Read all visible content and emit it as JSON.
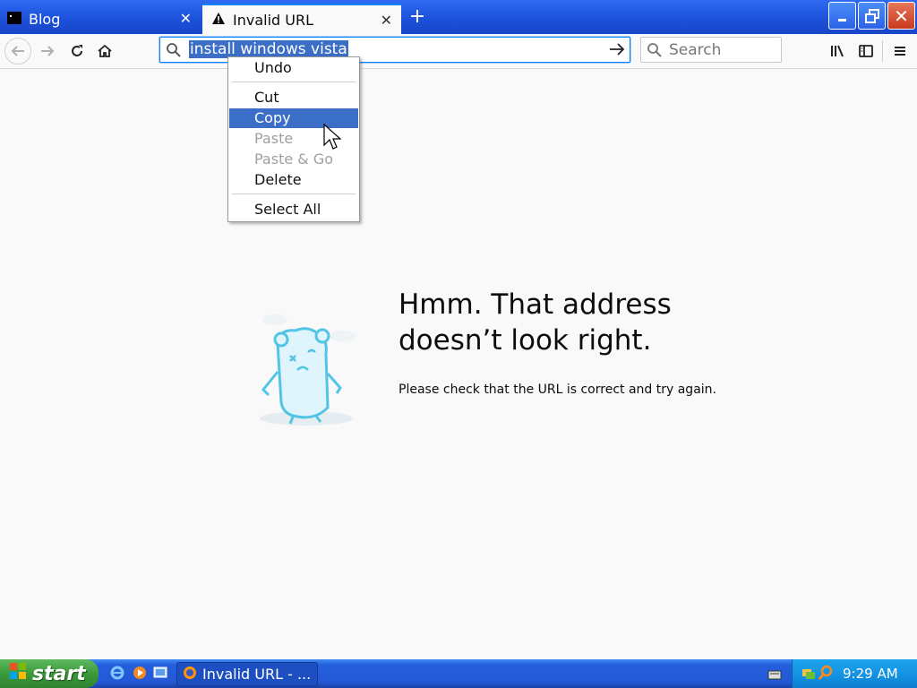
{
  "tabs": [
    {
      "label": "Blog",
      "close": "✕"
    },
    {
      "label": "Invalid URL",
      "close": "✕"
    }
  ],
  "new_tab": "+",
  "window_buttons": {
    "minimize": "_",
    "maximize": "❐",
    "close": "✕"
  },
  "urlbar": {
    "value": "install windows vista"
  },
  "searchbar": {
    "placeholder": "Search"
  },
  "context_menu": {
    "items": [
      {
        "label": "Undo",
        "state": "enabled"
      },
      {
        "label": "Cut",
        "state": "enabled"
      },
      {
        "label": "Copy",
        "state": "highlighted"
      },
      {
        "label": "Paste",
        "state": "disabled"
      },
      {
        "label": "Paste & Go",
        "state": "disabled"
      },
      {
        "label": "Delete",
        "state": "enabled"
      },
      {
        "label": "Select All",
        "state": "enabled"
      }
    ]
  },
  "error": {
    "title": "Hmm. That address doesn’t look right.",
    "description": "Please check that the URL is correct and try again."
  },
  "taskbar": {
    "start_label": "start",
    "task_item": "Invalid URL - ...",
    "clock": "9:29 AM"
  },
  "colors": {
    "accent": "#0a84ff",
    "menu_highlight": "#3a6ec7",
    "xp_taskbar": "#245edb",
    "xp_start": "#3b9a3b",
    "xp_tray": "#1290e0"
  }
}
